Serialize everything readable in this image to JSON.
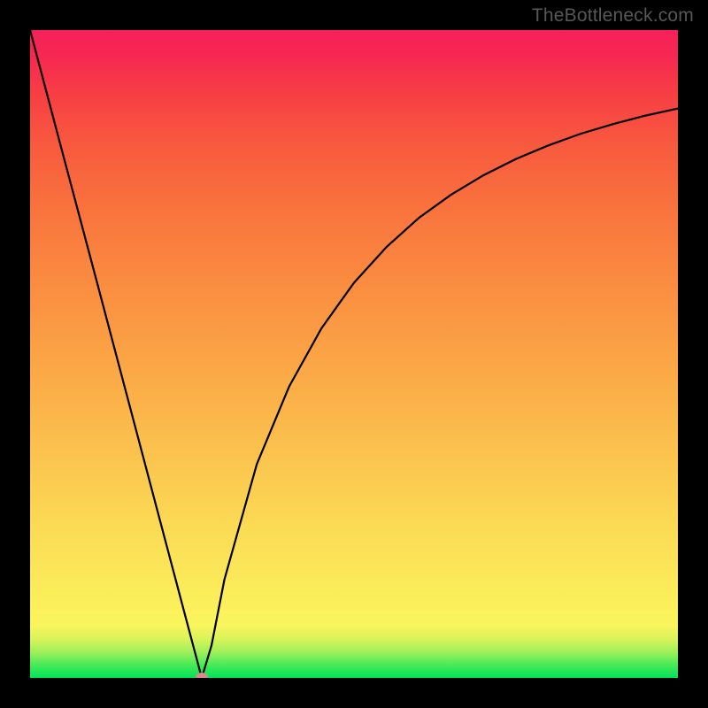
{
  "watermark": {
    "text": "TheBottleneck.com"
  },
  "chart_data": {
    "type": "line",
    "title": "",
    "xlabel": "",
    "ylabel": "",
    "xlim": [
      0,
      100
    ],
    "ylim": [
      0,
      100
    ],
    "series": [
      {
        "name": "bottleneck-curve",
        "x": [
          0,
          5,
          10,
          15,
          20,
          24,
          26.5,
          28,
          30,
          35,
          40,
          45,
          50,
          55,
          60,
          65,
          70,
          75,
          80,
          85,
          90,
          95,
          100
        ],
        "values": [
          100,
          81.1,
          62.3,
          43.4,
          24.5,
          9.4,
          0,
          5.0,
          15.2,
          33,
          45,
          54,
          61,
          66.5,
          71,
          74.6,
          77.6,
          80.1,
          82.2,
          84,
          85.5,
          86.8,
          87.9
        ]
      }
    ],
    "marker": {
      "series": "bottleneck-curve",
      "x": 26.5,
      "y": 0
    },
    "background_gradient": {
      "stops": [
        {
          "pos": 0.0,
          "color": "#00e35a"
        },
        {
          "pos": 0.05,
          "color": "#a0f05a"
        },
        {
          "pos": 0.08,
          "color": "#f7f55c"
        },
        {
          "pos": 0.5,
          "color": "#fba746"
        },
        {
          "pos": 0.9,
          "color": "#f73f44"
        },
        {
          "pos": 1.0,
          "color": "#f6205a"
        }
      ]
    }
  }
}
